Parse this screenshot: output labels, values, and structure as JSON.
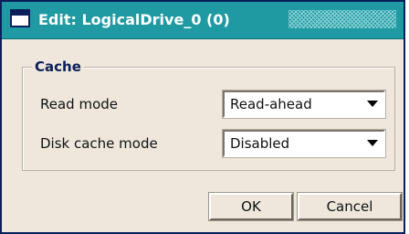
{
  "window": {
    "title": "Edit: LogicalDrive_0 (0)"
  },
  "cache_group": {
    "legend": "Cache",
    "read_mode": {
      "label": "Read mode",
      "value": "Read-ahead"
    },
    "disk_cache_mode": {
      "label": "Disk cache mode",
      "value": "Disabled"
    }
  },
  "buttons": {
    "ok": "OK",
    "cancel": "Cancel"
  }
}
